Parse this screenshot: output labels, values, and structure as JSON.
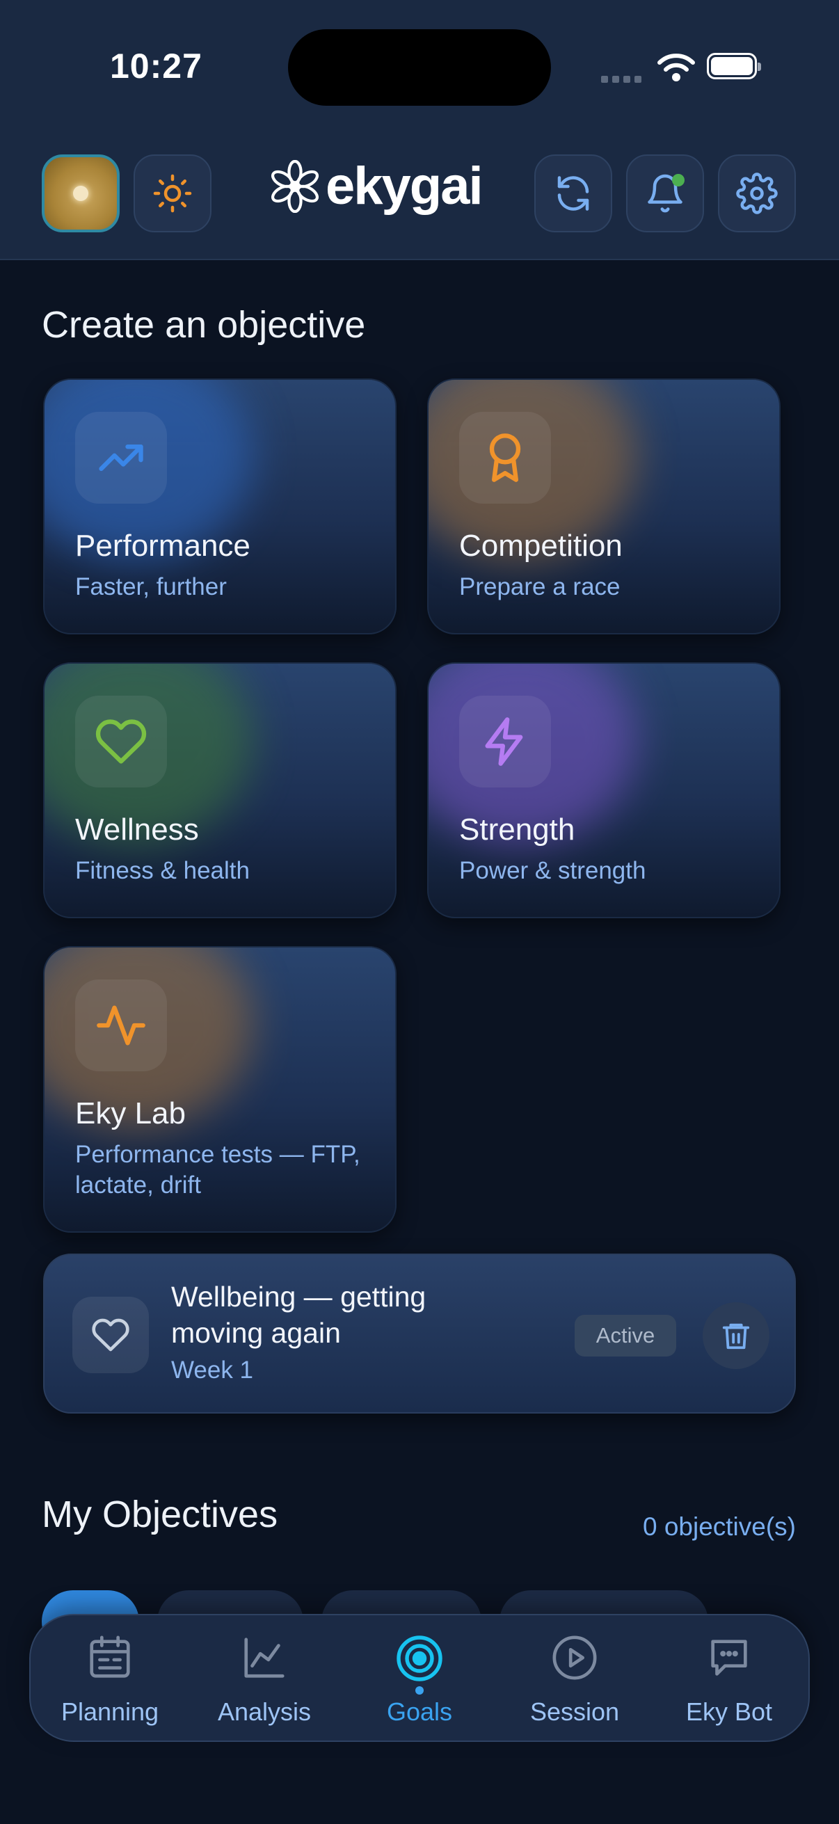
{
  "status_bar": {
    "time": "10:27"
  },
  "header": {
    "logo_text": "ekygai",
    "icons": [
      "sun-icon",
      "refresh-icon",
      "bell-icon",
      "gear-icon"
    ]
  },
  "create_section": {
    "title": "Create an objective",
    "cards": [
      {
        "title": "Performance",
        "subtitle": "Faster, further",
        "icon": "trending-up-icon",
        "color": "#3a86e8"
      },
      {
        "title": "Competition",
        "subtitle": "Prepare a race",
        "icon": "medal-icon",
        "color": "#f0932b"
      },
      {
        "title": "Wellness",
        "subtitle": "Fitness & health",
        "icon": "heart-icon",
        "color": "#7bc043"
      },
      {
        "title": "Strength",
        "subtitle": "Power & strength",
        "icon": "lightning-icon",
        "color": "#b57cf2"
      },
      {
        "title": "Eky Lab",
        "subtitle": "Performance tests — FTP, lactate, drift",
        "icon": "pulse-icon",
        "color": "#f0932b"
      }
    ]
  },
  "active_objective": {
    "title": "Wellbeing — getting moving again",
    "week": "Week 1",
    "badge": "Active",
    "icon": "heart-icon"
  },
  "my_objectives": {
    "title": "My Objectives",
    "count": "0 objective(s)"
  },
  "bottom_nav": {
    "items": [
      {
        "label": "Planning",
        "icon": "calendar-icon"
      },
      {
        "label": "Analysis",
        "icon": "chart-icon"
      },
      {
        "label": "Goals",
        "icon": "target-icon",
        "active": true
      },
      {
        "label": "Session",
        "icon": "play-icon"
      },
      {
        "label": "Eky Bot",
        "icon": "chat-icon"
      }
    ]
  },
  "colors": {
    "background": "#0b1322",
    "header": "#1a2942",
    "accent": "#3aa3f0",
    "subtitle": "#8eb6ee"
  }
}
